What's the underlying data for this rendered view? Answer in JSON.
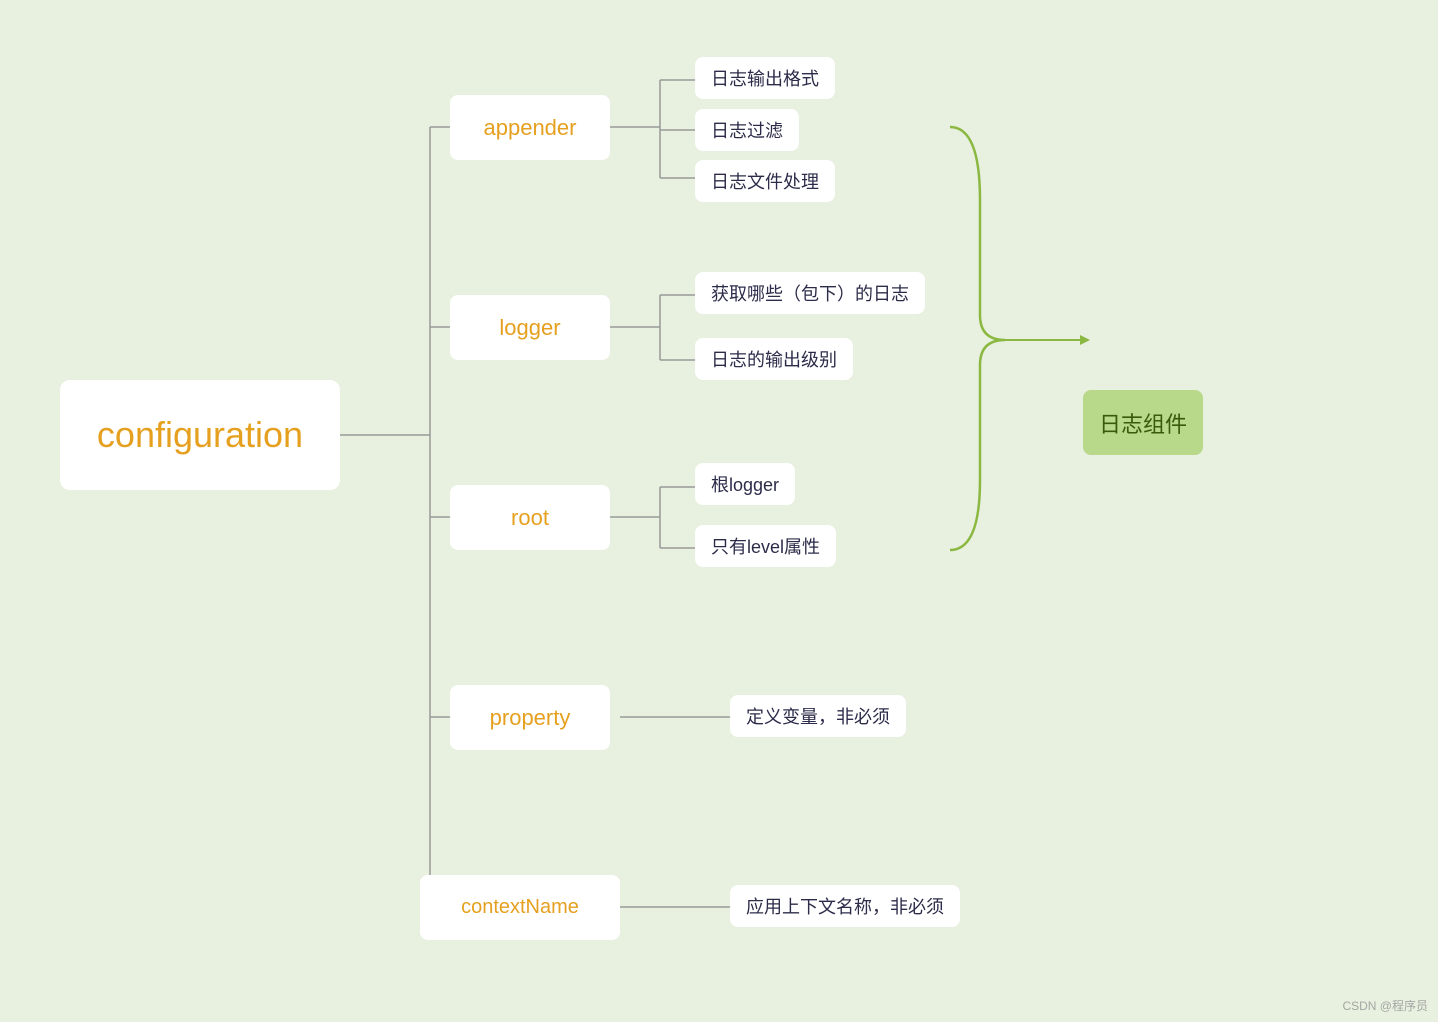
{
  "nodes": {
    "configuration": {
      "label": "configuration"
    },
    "appender": {
      "label": "appender"
    },
    "logger": {
      "label": "logger"
    },
    "root": {
      "label": "root"
    },
    "property": {
      "label": "property"
    },
    "contextName": {
      "label": "contextName"
    },
    "logComponent": {
      "label": "日志组件"
    },
    "leaf1": {
      "label": "日志输出格式"
    },
    "leaf2": {
      "label": "日志过滤"
    },
    "leaf3": {
      "label": "日志文件处理"
    },
    "leaf4": {
      "label": "获取哪些（包下）的日志"
    },
    "leaf5": {
      "label": "日志的输出级别"
    },
    "leaf6": {
      "label": "根logger"
    },
    "leaf7": {
      "label": "只有level属性"
    },
    "leaf8": {
      "label": "定义变量，非必须"
    },
    "leaf9": {
      "label": "应用上下文名称，非必须"
    }
  },
  "watermark": "CSDN @程序员"
}
